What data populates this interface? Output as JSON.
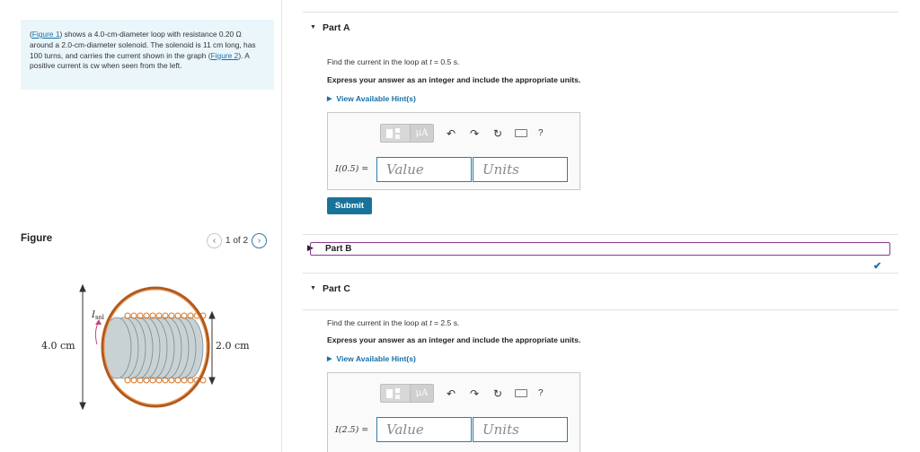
{
  "problem": {
    "figure1_link": "Figure 1",
    "text1": ") shows a 4.0-cm-diameter loop with resistance 0.20 Ω around a 2.0-cm-diameter solenoid. The solenoid is 11 cm long, has 100 turns, and carries the current shown in the graph (",
    "figure2_link": "Figure 2",
    "text2": "). A positive current is cw when seen from the left."
  },
  "figure_panel": {
    "label": "Figure",
    "page_indicator": "1 of 2",
    "prev_icon": "chevron-left-icon",
    "next_icon": "chevron-right-icon",
    "diagram": {
      "loop_diameter_label": "4.0 cm",
      "solenoid_diameter_label": "2.0 cm",
      "current_label_main": "I",
      "current_label_sub": "sol"
    }
  },
  "parts": {
    "a": {
      "title": "Part A",
      "prompt_prefix": "Find the current in the loop at ",
      "prompt_var": "t",
      "prompt_suffix": " = 0.5 s.",
      "instruction": "Express your answer as an integer and include the appropriate units.",
      "hint": "View Available Hint(s)",
      "eq_label": "I(0.5) =",
      "value_placeholder": "Value",
      "units_placeholder": "Units",
      "submit_label": "Submit"
    },
    "b": {
      "title": "Part B"
    },
    "c": {
      "title": "Part C",
      "prompt_prefix": "Find the current in the loop at ",
      "prompt_var": "t",
      "prompt_suffix": " = 2.5 s.",
      "instruction": "Express your answer as an integer and include the appropriate units.",
      "hint": "View Available Hint(s)",
      "eq_label": "I(2.5) =",
      "value_placeholder": "Value",
      "units_placeholder": "Units"
    }
  },
  "toolbar": {
    "mu_label": "μA",
    "help_label": "?",
    "icons": [
      "templates-icon",
      "undo-icon",
      "redo-icon",
      "reset-icon",
      "keyboard-icon",
      "help-icon"
    ]
  },
  "colors": {
    "accent": "#18739a",
    "link": "#1a6fa8",
    "active_part_border": "#8a3a8f",
    "problem_bg": "#eaf6fa",
    "coil_orange": "#e07a2a",
    "solenoid_gray": "#c8d2d4"
  }
}
